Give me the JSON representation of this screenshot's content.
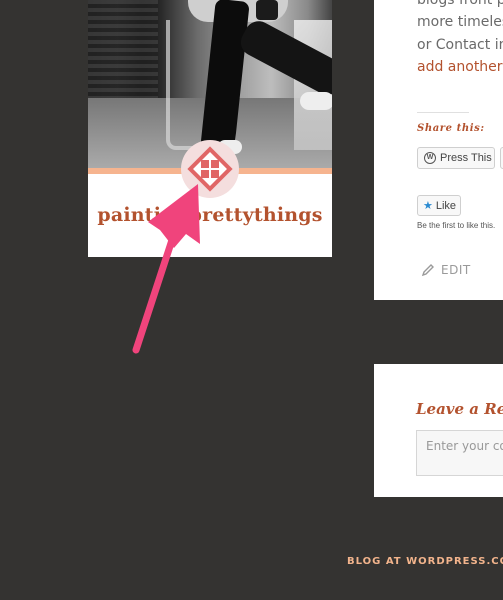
{
  "profile": {
    "blog_name": "paintingprettythings"
  },
  "post": {
    "lines": [
      "blogs front pa",
      "more timeless",
      "or Contact info",
      "add another p"
    ],
    "share_title": "Share this:",
    "press_this_label": "Press This",
    "like_label": "Like",
    "like_note": "Be the first to like this.",
    "edit_label": "EDIT"
  },
  "reply": {
    "title": "Leave a Re",
    "placeholder": "Enter your comment here..."
  },
  "footer": {
    "link_label": "BLOG AT WORDPRESS.COM."
  },
  "colors": {
    "background": "#343331",
    "accent": "#b3522e",
    "stripe": "#f6b48f",
    "arrow": "#f0447c",
    "footer_link": "#f2b48c"
  },
  "icons": {
    "wordpress": "wordpress-icon",
    "star": "star-icon",
    "edit": "pencil-icon",
    "logo": "blavatar-logo-icon"
  }
}
